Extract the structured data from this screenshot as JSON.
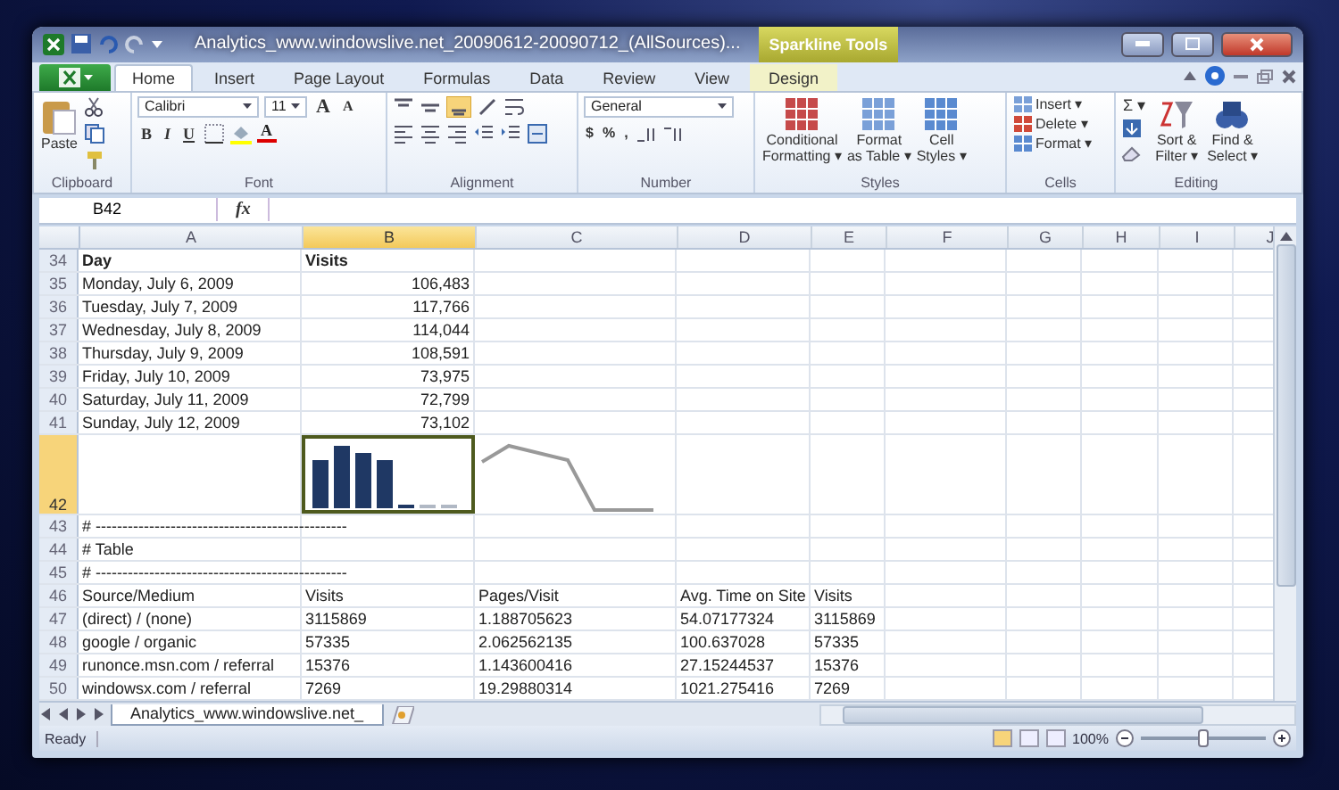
{
  "window": {
    "title": "Analytics_www.windowslive.net_20090612-20090712_(AllSources)...",
    "context_label": "Sparkline Tools"
  },
  "tabs": [
    {
      "label": "Home",
      "selected": true,
      "contextual": false
    },
    {
      "label": "Insert",
      "selected": false,
      "contextual": false
    },
    {
      "label": "Page Layout",
      "selected": false,
      "contextual": false
    },
    {
      "label": "Formulas",
      "selected": false,
      "contextual": false
    },
    {
      "label": "Data",
      "selected": false,
      "contextual": false
    },
    {
      "label": "Review",
      "selected": false,
      "contextual": false
    },
    {
      "label": "View",
      "selected": false,
      "contextual": false
    },
    {
      "label": "Design",
      "selected": false,
      "contextual": true
    }
  ],
  "ribbon": {
    "clipboard": {
      "paste": "Paste",
      "label": "Clipboard"
    },
    "font": {
      "name": "Calibri",
      "size": "11",
      "grow": "A",
      "shrink": "A",
      "bold": "B",
      "italic": "I",
      "underline": "U",
      "color_glyph": "A",
      "label": "Font"
    },
    "alignment": {
      "label": "Alignment"
    },
    "number": {
      "format": "General",
      "currency": "$",
      "percent": "%",
      "comma": ",",
      "label": "Number"
    },
    "styles": {
      "buttons": [
        {
          "lines": [
            "Conditional",
            "Formatting ▾"
          ]
        },
        {
          "lines": [
            "Format",
            "as Table ▾"
          ]
        },
        {
          "lines": [
            "Cell",
            "Styles ▾"
          ]
        }
      ],
      "label": "Styles"
    },
    "cells": {
      "buttons": [
        "Insert ▾",
        "Delete ▾",
        "Format ▾"
      ],
      "label": "Cells"
    },
    "editing": {
      "sum": "Σ ▾",
      "buttons": [
        {
          "lines": [
            "Sort &",
            "Filter ▾"
          ]
        },
        {
          "lines": [
            "Find &",
            "Select ▾"
          ]
        }
      ],
      "label": "Editing"
    }
  },
  "formula_bar": {
    "name_box": "B42",
    "function_glyph": "fx"
  },
  "columns": [
    {
      "label": "A",
      "selected": false
    },
    {
      "label": "B",
      "selected": true
    },
    {
      "label": "C",
      "selected": false
    },
    {
      "label": "D",
      "selected": false
    },
    {
      "label": "E",
      "selected": false
    },
    {
      "label": "F",
      "selected": false
    },
    {
      "label": "G",
      "selected": false
    },
    {
      "label": "H",
      "selected": false
    },
    {
      "label": "I",
      "selected": false
    },
    {
      "label": "J",
      "selected": false
    }
  ],
  "rows": [
    {
      "num": "34",
      "kind": "heading",
      "selected": false,
      "cells": [
        "Day",
        "Visits"
      ]
    },
    {
      "num": "35",
      "kind": "numbers",
      "selected": false,
      "cells": [
        "Monday, July 6, 2009",
        "106,483"
      ]
    },
    {
      "num": "36",
      "kind": "numbers",
      "selected": false,
      "cells": [
        "Tuesday, July 7, 2009",
        "117,766"
      ]
    },
    {
      "num": "37",
      "kind": "numbers",
      "selected": false,
      "cells": [
        "Wednesday, July 8, 2009",
        "114,044"
      ]
    },
    {
      "num": "38",
      "kind": "numbers",
      "selected": false,
      "cells": [
        "Thursday, July 9, 2009",
        "108,591"
      ]
    },
    {
      "num": "39",
      "kind": "numbers",
      "selected": false,
      "cells": [
        "Friday, July 10, 2009",
        "73,975"
      ]
    },
    {
      "num": "40",
      "kind": "numbers",
      "selected": false,
      "cells": [
        "Saturday, July 11, 2009",
        "72,799"
      ]
    },
    {
      "num": "41",
      "kind": "numbers",
      "selected": false,
      "cells": [
        "Sunday, July 12, 2009",
        "73,102"
      ]
    },
    {
      "num": "42",
      "kind": "sparkline",
      "selected": true,
      "cells": []
    },
    {
      "num": "43",
      "kind": "text",
      "selected": false,
      "cells": [
        "# -----------------------------------------------"
      ]
    },
    {
      "num": "44",
      "kind": "text",
      "selected": false,
      "cells": [
        "# Table"
      ]
    },
    {
      "num": "45",
      "kind": "text",
      "selected": false,
      "cells": [
        "# -----------------------------------------------"
      ]
    },
    {
      "num": "46",
      "kind": "text",
      "selected": false,
      "cells": [
        "Source/Medium",
        "Visits",
        "Pages/Visit",
        "Avg. Time on Site",
        "Visits"
      ]
    },
    {
      "num": "47",
      "kind": "text",
      "selected": false,
      "cells": [
        "(direct) / (none)",
        "3115869",
        "1.188705623",
        "54.07177324",
        "3115869"
      ]
    },
    {
      "num": "48",
      "kind": "text",
      "selected": false,
      "cells": [
        "google / organic",
        "57335",
        "2.062562135",
        "100.637028",
        "57335"
      ]
    },
    {
      "num": "49",
      "kind": "text",
      "selected": false,
      "cells": [
        "runonce.msn.com / referral",
        "15376",
        "1.143600416",
        "27.15244537",
        "15376"
      ]
    },
    {
      "num": "50",
      "kind": "text",
      "selected": false,
      "cells": [
        "windowsx.com / referral",
        "7269",
        "19.29880314",
        "1021.275416",
        "7269"
      ]
    }
  ],
  "sheet_tabs": [
    {
      "label": "Analytics_www.windowslive.net_",
      "selected": true
    }
  ],
  "status_bar": {
    "text": "Ready",
    "zoom": "100%",
    "zoom_slider": {
      "level": 0.5
    }
  }
}
